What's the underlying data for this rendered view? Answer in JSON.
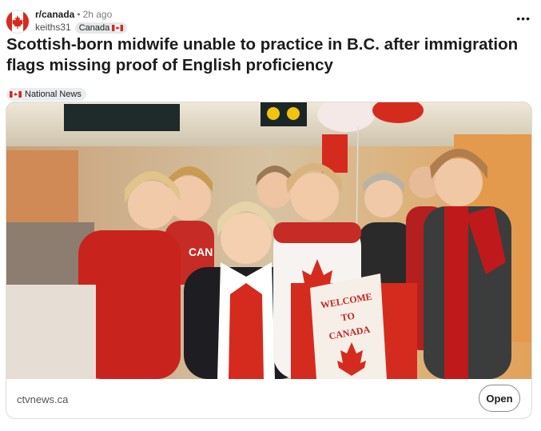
{
  "post": {
    "subreddit": "r/canada",
    "separator": "•",
    "time_ago": "2h ago",
    "author": "keiths31",
    "user_flair": "Canada",
    "user_flair_icon": "canada-flag-icon",
    "more_icon": "more-options-icon",
    "title": "Scottish-born midwife unable to practice in B.C. after immigration flags missing proof of English proficiency",
    "post_flair": "National News",
    "post_flair_icon": "canada-flag-icon"
  },
  "link_card": {
    "domain": "ctvnews.ca",
    "open_label": "Open",
    "image": {
      "sign_text": [
        "WELCOME",
        "TO",
        "CANADA"
      ],
      "shirt_text": "CAN"
    }
  },
  "colors": {
    "canada_red": "#d52b1e",
    "text": "#1c1c1c",
    "muted": "#7c7c7c",
    "flair_bg": "#e5e8ea",
    "border": "#dcdcdc"
  }
}
